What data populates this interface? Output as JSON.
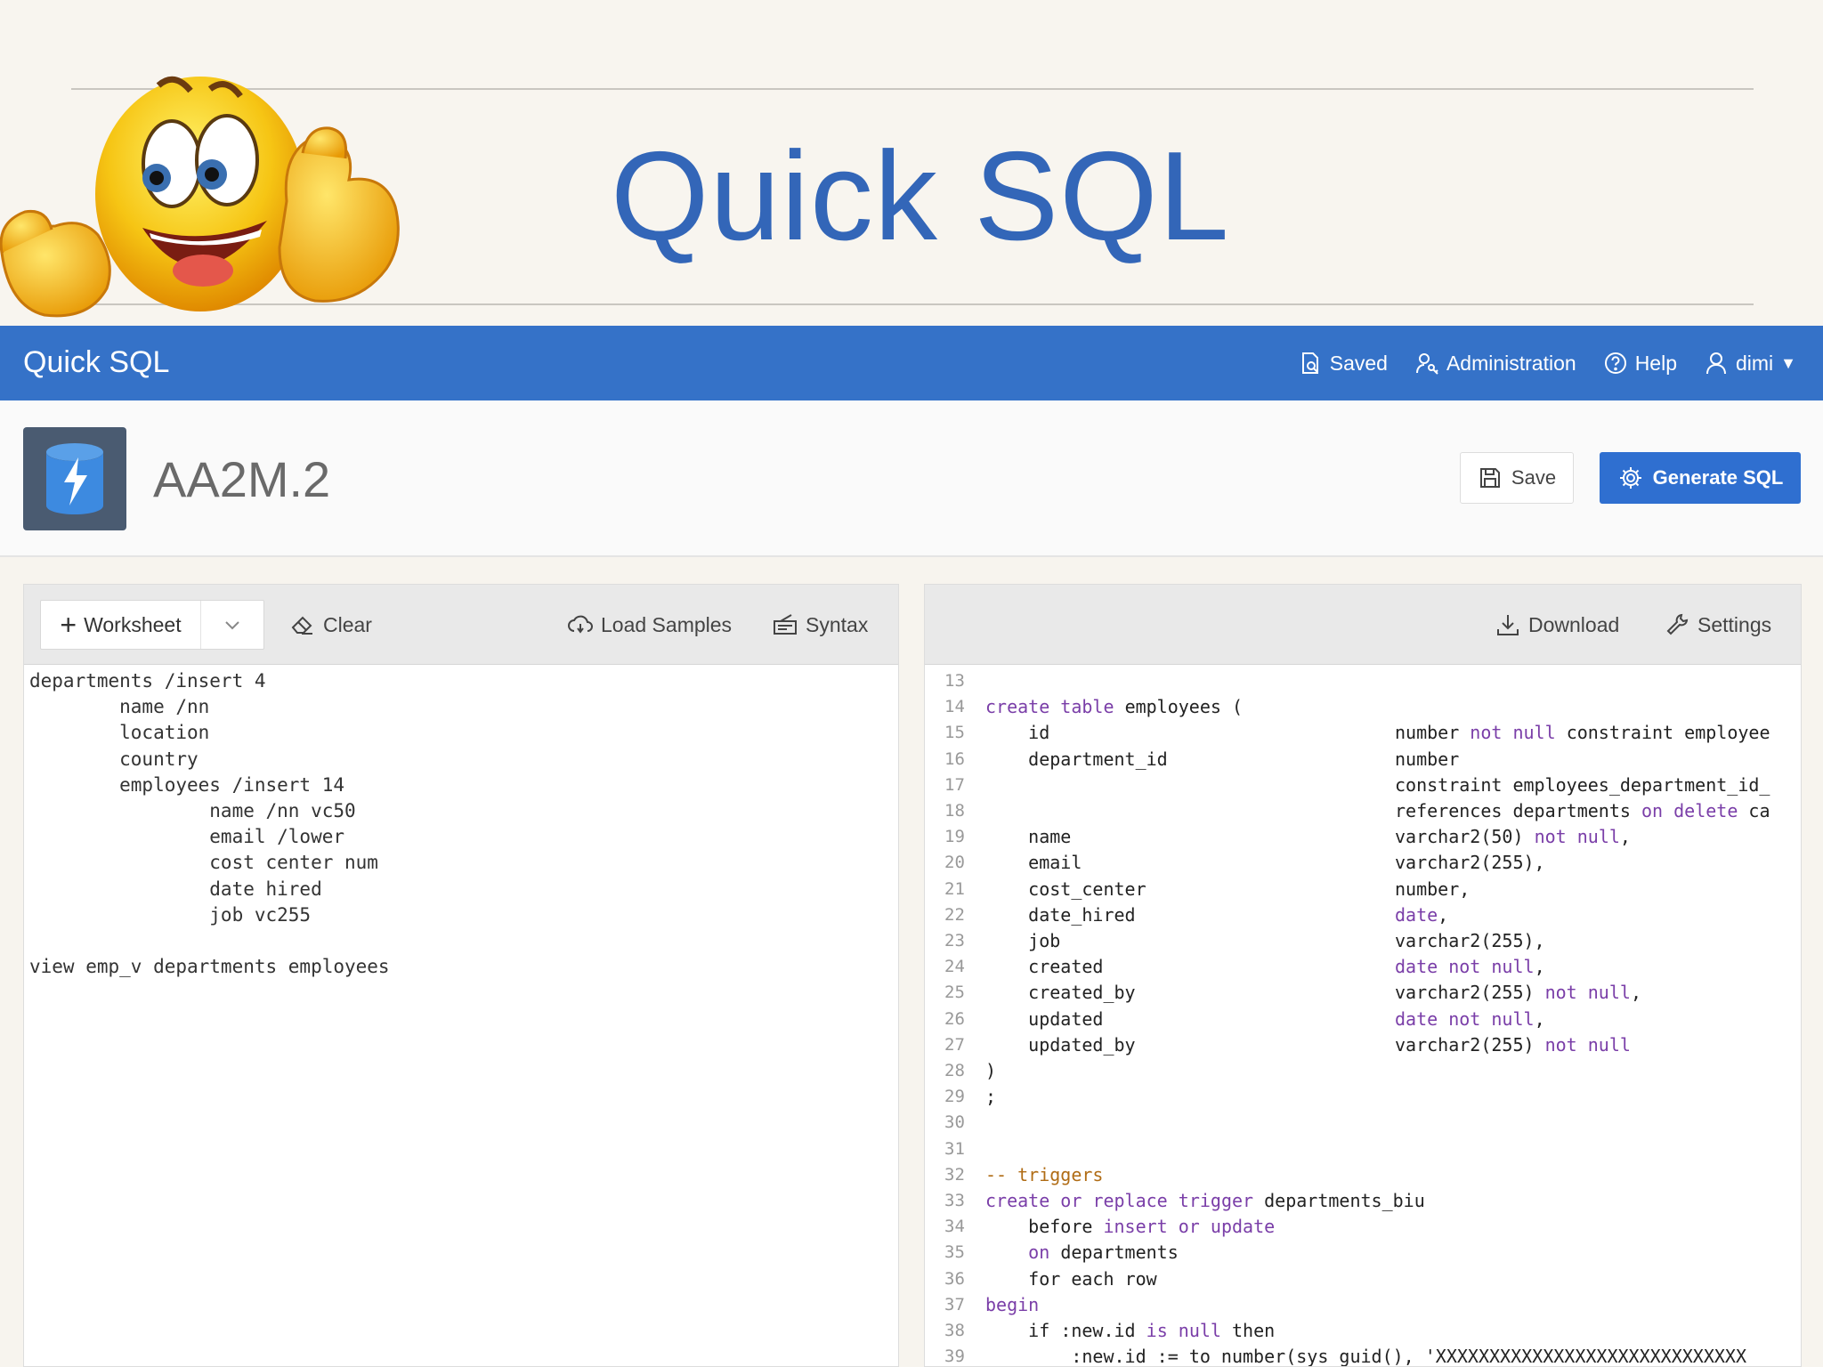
{
  "slide": {
    "title": "Quick SQL"
  },
  "appbar": {
    "title": "Quick SQL",
    "nav": [
      {
        "icon": "document-search-icon",
        "label": "Saved"
      },
      {
        "icon": "user-key-icon",
        "label": "Administration"
      },
      {
        "icon": "help-circle-icon",
        "label": "Help"
      },
      {
        "icon": "user-icon",
        "label": "dimi"
      }
    ]
  },
  "page": {
    "app_name": "AA2M.2",
    "save_label": "Save",
    "generate_label": "Generate SQL"
  },
  "left_toolbar": {
    "worksheet_label": "Worksheet",
    "clear_label": "Clear",
    "load_samples_label": "Load Samples",
    "syntax_label": "Syntax"
  },
  "right_toolbar": {
    "download_label": "Download",
    "settings_label": "Settings"
  },
  "quicksql_lines": [
    "departments /insert 4",
    "        name /nn",
    "        location",
    "        country",
    "        employees /insert 14",
    "                name /nn vc50",
    "                email /lower",
    "                cost center num",
    "                date hired",
    "                job vc255",
    "",
    "view emp_v departments employees"
  ],
  "sql_lines": [
    {
      "n": "13",
      "a": "",
      "b": ""
    },
    {
      "n": "14",
      "a": "create table employees (",
      "b": ""
    },
    {
      "n": "15",
      "a": "    id",
      "b": "number not null constraint employee"
    },
    {
      "n": "16",
      "a": "    department_id",
      "b": "number"
    },
    {
      "n": "17",
      "a": "",
      "b": "constraint employees_department_id_"
    },
    {
      "n": "18",
      "a": "",
      "b": "references departments on delete ca"
    },
    {
      "n": "19",
      "a": "    name",
      "b": "varchar2(50) not null,"
    },
    {
      "n": "20",
      "a": "    email",
      "b": "varchar2(255),"
    },
    {
      "n": "21",
      "a": "    cost_center",
      "b": "number,"
    },
    {
      "n": "22",
      "a": "    date_hired",
      "b": "date,"
    },
    {
      "n": "23",
      "a": "    job",
      "b": "varchar2(255),"
    },
    {
      "n": "24",
      "a": "    created",
      "b": "date not null,"
    },
    {
      "n": "25",
      "a": "    created_by",
      "b": "varchar2(255) not null,"
    },
    {
      "n": "26",
      "a": "    updated",
      "b": "date not null,"
    },
    {
      "n": "27",
      "a": "    updated_by",
      "b": "varchar2(255) not null"
    },
    {
      "n": "28",
      "a": ")",
      "b": ""
    },
    {
      "n": "29",
      "a": ";",
      "b": ""
    },
    {
      "n": "30",
      "a": "",
      "b": ""
    },
    {
      "n": "31",
      "a": "",
      "b": ""
    },
    {
      "n": "32",
      "a": "-- triggers",
      "b": ""
    },
    {
      "n": "33",
      "a": "create or replace trigger departments_biu",
      "b": ""
    },
    {
      "n": "34",
      "a": "    before insert or update",
      "b": ""
    },
    {
      "n": "35",
      "a": "    on departments",
      "b": ""
    },
    {
      "n": "36",
      "a": "    for each row",
      "b": ""
    },
    {
      "n": "37",
      "a": "begin",
      "b": ""
    },
    {
      "n": "38",
      "a": "    if :new.id is null then",
      "b": ""
    },
    {
      "n": "39",
      "a": "        :new.id := to_number(sys_guid(), 'XXXXXXXXXXXXXXXXXXXXXXXXXXXXX",
      "b": ""
    }
  ],
  "colors": {
    "appbar": "#3572c8",
    "title_blue": "#3366b8",
    "generate_button": "#2f6fd0",
    "keyword": "#7a3ea8",
    "comment": "#b06c15"
  }
}
